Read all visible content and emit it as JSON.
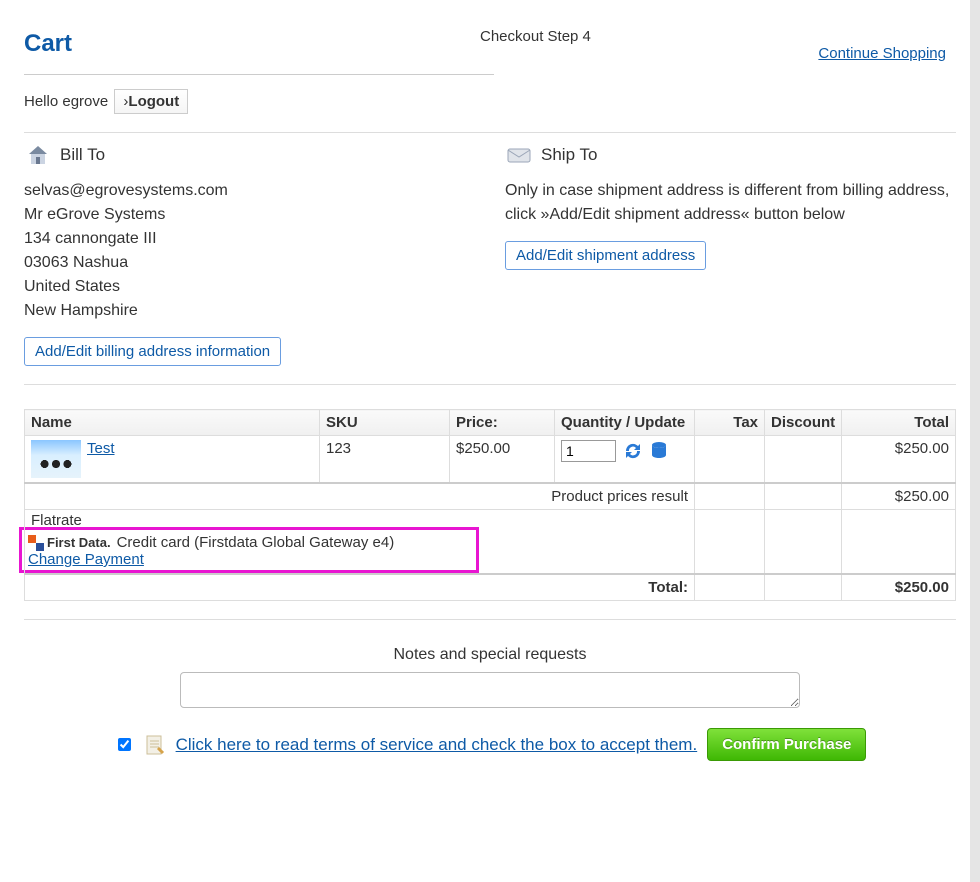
{
  "header": {
    "cart_title": "Cart",
    "checkout_step": "Checkout Step 4",
    "continue_shopping": "Continue Shopping",
    "hello_prefix": "Hello ",
    "username": "egrove",
    "logout_label": "Logout"
  },
  "bill_to": {
    "heading": "Bill To",
    "email": "selvas@egrovesystems.com",
    "name": "Mr eGrove Systems",
    "street": "134 cannongate III",
    "city_zip": "03063 Nashua",
    "country": "United States",
    "state": "New Hampshire",
    "button": "Add/Edit billing address information"
  },
  "ship_to": {
    "heading": "Ship To",
    "note": "Only in case shipment address is different from billing address, click »Add/Edit shipment address« button below",
    "button": "Add/Edit shipment address"
  },
  "table": {
    "columns": {
      "name": "Name",
      "sku": "SKU",
      "price": "Price:",
      "qty": "Quantity / Update",
      "tax": "Tax",
      "discount": "Discount",
      "total": "Total"
    },
    "rows": [
      {
        "name": "Test",
        "sku": "123",
        "price": "$250.00",
        "qty": "1",
        "total": "$250.00"
      }
    ],
    "product_prices_result_label": "Product prices result",
    "product_prices_result_value": "$250.00",
    "flatrate_label": "Flatrate",
    "payment_method_text": "Credit card (Firstdata Global Gateway e4)",
    "firstdata_brand": "First Data.",
    "change_payment": "Change Payment",
    "total_label": "Total:",
    "total_value": "$250.00"
  },
  "notes": {
    "label": "Notes and special requests",
    "value": ""
  },
  "terms": {
    "checkbox_checked": true,
    "link_text": " Click here to read terms of service and check the box to accept them.",
    "confirm_label": "Confirm Purchase"
  }
}
